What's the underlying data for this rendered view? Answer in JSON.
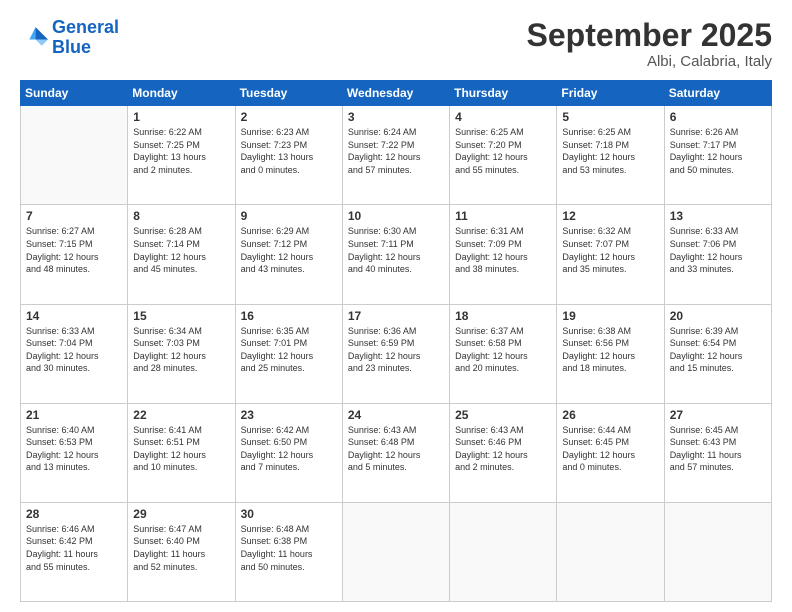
{
  "logo": {
    "line1": "General",
    "line2": "Blue"
  },
  "header": {
    "month": "September 2025",
    "location": "Albi, Calabria, Italy"
  },
  "weekdays": [
    "Sunday",
    "Monday",
    "Tuesday",
    "Wednesday",
    "Thursday",
    "Friday",
    "Saturday"
  ],
  "weeks": [
    [
      {
        "day": "",
        "info": ""
      },
      {
        "day": "1",
        "info": "Sunrise: 6:22 AM\nSunset: 7:25 PM\nDaylight: 13 hours\nand 2 minutes."
      },
      {
        "day": "2",
        "info": "Sunrise: 6:23 AM\nSunset: 7:23 PM\nDaylight: 13 hours\nand 0 minutes."
      },
      {
        "day": "3",
        "info": "Sunrise: 6:24 AM\nSunset: 7:22 PM\nDaylight: 12 hours\nand 57 minutes."
      },
      {
        "day": "4",
        "info": "Sunrise: 6:25 AM\nSunset: 7:20 PM\nDaylight: 12 hours\nand 55 minutes."
      },
      {
        "day": "5",
        "info": "Sunrise: 6:25 AM\nSunset: 7:18 PM\nDaylight: 12 hours\nand 53 minutes."
      },
      {
        "day": "6",
        "info": "Sunrise: 6:26 AM\nSunset: 7:17 PM\nDaylight: 12 hours\nand 50 minutes."
      }
    ],
    [
      {
        "day": "7",
        "info": "Sunrise: 6:27 AM\nSunset: 7:15 PM\nDaylight: 12 hours\nand 48 minutes."
      },
      {
        "day": "8",
        "info": "Sunrise: 6:28 AM\nSunset: 7:14 PM\nDaylight: 12 hours\nand 45 minutes."
      },
      {
        "day": "9",
        "info": "Sunrise: 6:29 AM\nSunset: 7:12 PM\nDaylight: 12 hours\nand 43 minutes."
      },
      {
        "day": "10",
        "info": "Sunrise: 6:30 AM\nSunset: 7:11 PM\nDaylight: 12 hours\nand 40 minutes."
      },
      {
        "day": "11",
        "info": "Sunrise: 6:31 AM\nSunset: 7:09 PM\nDaylight: 12 hours\nand 38 minutes."
      },
      {
        "day": "12",
        "info": "Sunrise: 6:32 AM\nSunset: 7:07 PM\nDaylight: 12 hours\nand 35 minutes."
      },
      {
        "day": "13",
        "info": "Sunrise: 6:33 AM\nSunset: 7:06 PM\nDaylight: 12 hours\nand 33 minutes."
      }
    ],
    [
      {
        "day": "14",
        "info": "Sunrise: 6:33 AM\nSunset: 7:04 PM\nDaylight: 12 hours\nand 30 minutes."
      },
      {
        "day": "15",
        "info": "Sunrise: 6:34 AM\nSunset: 7:03 PM\nDaylight: 12 hours\nand 28 minutes."
      },
      {
        "day": "16",
        "info": "Sunrise: 6:35 AM\nSunset: 7:01 PM\nDaylight: 12 hours\nand 25 minutes."
      },
      {
        "day": "17",
        "info": "Sunrise: 6:36 AM\nSunset: 6:59 PM\nDaylight: 12 hours\nand 23 minutes."
      },
      {
        "day": "18",
        "info": "Sunrise: 6:37 AM\nSunset: 6:58 PM\nDaylight: 12 hours\nand 20 minutes."
      },
      {
        "day": "19",
        "info": "Sunrise: 6:38 AM\nSunset: 6:56 PM\nDaylight: 12 hours\nand 18 minutes."
      },
      {
        "day": "20",
        "info": "Sunrise: 6:39 AM\nSunset: 6:54 PM\nDaylight: 12 hours\nand 15 minutes."
      }
    ],
    [
      {
        "day": "21",
        "info": "Sunrise: 6:40 AM\nSunset: 6:53 PM\nDaylight: 12 hours\nand 13 minutes."
      },
      {
        "day": "22",
        "info": "Sunrise: 6:41 AM\nSunset: 6:51 PM\nDaylight: 12 hours\nand 10 minutes."
      },
      {
        "day": "23",
        "info": "Sunrise: 6:42 AM\nSunset: 6:50 PM\nDaylight: 12 hours\nand 7 minutes."
      },
      {
        "day": "24",
        "info": "Sunrise: 6:43 AM\nSunset: 6:48 PM\nDaylight: 12 hours\nand 5 minutes."
      },
      {
        "day": "25",
        "info": "Sunrise: 6:43 AM\nSunset: 6:46 PM\nDaylight: 12 hours\nand 2 minutes."
      },
      {
        "day": "26",
        "info": "Sunrise: 6:44 AM\nSunset: 6:45 PM\nDaylight: 12 hours\nand 0 minutes."
      },
      {
        "day": "27",
        "info": "Sunrise: 6:45 AM\nSunset: 6:43 PM\nDaylight: 11 hours\nand 57 minutes."
      }
    ],
    [
      {
        "day": "28",
        "info": "Sunrise: 6:46 AM\nSunset: 6:42 PM\nDaylight: 11 hours\nand 55 minutes."
      },
      {
        "day": "29",
        "info": "Sunrise: 6:47 AM\nSunset: 6:40 PM\nDaylight: 11 hours\nand 52 minutes."
      },
      {
        "day": "30",
        "info": "Sunrise: 6:48 AM\nSunset: 6:38 PM\nDaylight: 11 hours\nand 50 minutes."
      },
      {
        "day": "",
        "info": ""
      },
      {
        "day": "",
        "info": ""
      },
      {
        "day": "",
        "info": ""
      },
      {
        "day": "",
        "info": ""
      }
    ]
  ]
}
